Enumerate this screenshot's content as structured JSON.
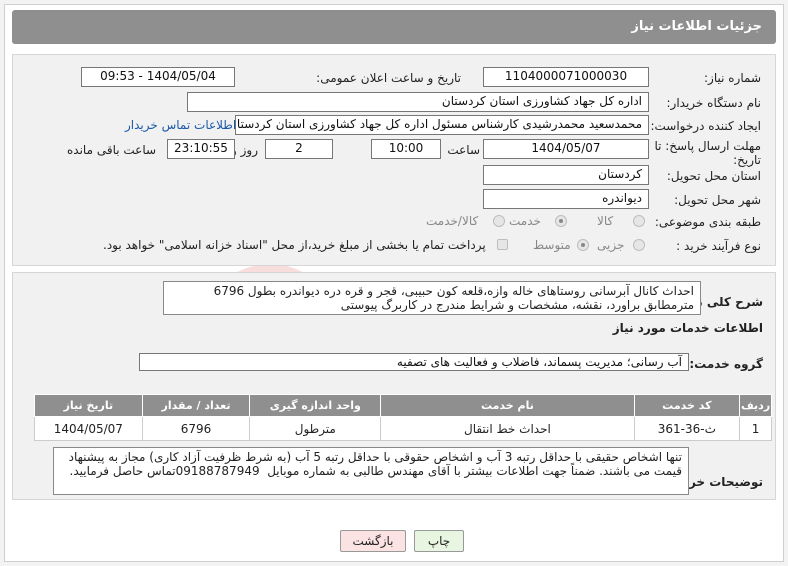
{
  "header": {
    "title": "جزئیات اطلاعات نیاز"
  },
  "form": {
    "need_number_label": "شماره نیاز:",
    "need_number": "1104000071000030",
    "announce_label": "تاریخ و ساعت اعلان عمومی:",
    "announce_value": "1404/05/04 - 09:53",
    "buyer_org_label": "نام دستگاه خریدار:",
    "buyer_org": "اداره کل جهاد کشاورزی استان کردستان",
    "creator_label": "ایجاد کننده درخواست:",
    "creator": "محمدسعید محمدرشیدی کارشناس مسئول اداره کل جهاد کشاورزی استان کردستان",
    "contact_link": "اطلاعات تماس خریدار",
    "deadline_label_1": "مهلت ارسال پاسخ: تا",
    "deadline_label_2": "تاریخ:",
    "deadline_date": "1404/05/07",
    "time_label": "ساعت",
    "deadline_time": "10:00",
    "days_value": "2",
    "days_label": "روز و",
    "remaining_time": "23:10:55",
    "remaining_label": "ساعت باقی مانده",
    "province_label": "استان محل تحویل:",
    "province": "کردستان",
    "city_label": "شهر محل تحویل:",
    "city": "دیواندره",
    "category_label": "طبقه بندی موضوعی:",
    "category_options": [
      "کالا",
      "خدمت",
      "کالا/خدمت"
    ],
    "category_selected": "خدمت",
    "process_label": "نوع فرآیند خرید :",
    "process_options": [
      "جزیی",
      "متوسط"
    ],
    "process_selected": "متوسط",
    "payment_note": "پرداخت تمام یا بخشی از مبلغ خرید،از محل \"اسناد خزانه اسلامی\" خواهد بود."
  },
  "summary": {
    "label": "شرح کلی نیاز:",
    "text": "احداث کانال آبرسانی روستاهای خاله وازه،قلعه کون حبیبی، قجر و قره دره دیواندره بطول 6796 مترمطابق براورد، نقشه، مشخصات و شرایط مندرج در کاربرگ پیوستی"
  },
  "services": {
    "section_title": "اطلاعات خدمات مورد نیاز",
    "group_label": "گروه خدمت:",
    "group_value": "آب رسانی؛ مدیریت پسماند، فاضلاب و فعالیت های تصفیه",
    "columns": [
      "ردیف",
      "کد خدمت",
      "نام خدمت",
      "واحد اندازه گیری",
      "تعداد / مقدار",
      "تاریخ نیاز"
    ],
    "rows": [
      [
        "1",
        "ث-36-361",
        "احداث خط انتقال",
        "مترطول",
        "6796",
        "1404/05/07"
      ]
    ]
  },
  "buyer_notes": {
    "label": "توضیحات خریدار:",
    "text": "تنها اشخاص حقیقی با حداقل رتبه 3 آب و اشخاص حقوقی با حداقل رتبه 5 آب (به شرط ظرفیت آزاد کاری) مجاز به پیشنهاد قیمت می باشند. ضمناً جهت اطلاعات بیشتر با آقای مهندس طالبی به شماره موبایل  09188787949تماس حاصل فرمایید."
  },
  "buttons": {
    "print": "چاپ",
    "back": "بازگشت"
  },
  "colors": {
    "header_bg": "#8f8f8f",
    "link": "#1a5aa8",
    "print_bg": "#e8f5e0",
    "back_bg": "#fbe3e3"
  },
  "watermark": "AriaTender.neT"
}
